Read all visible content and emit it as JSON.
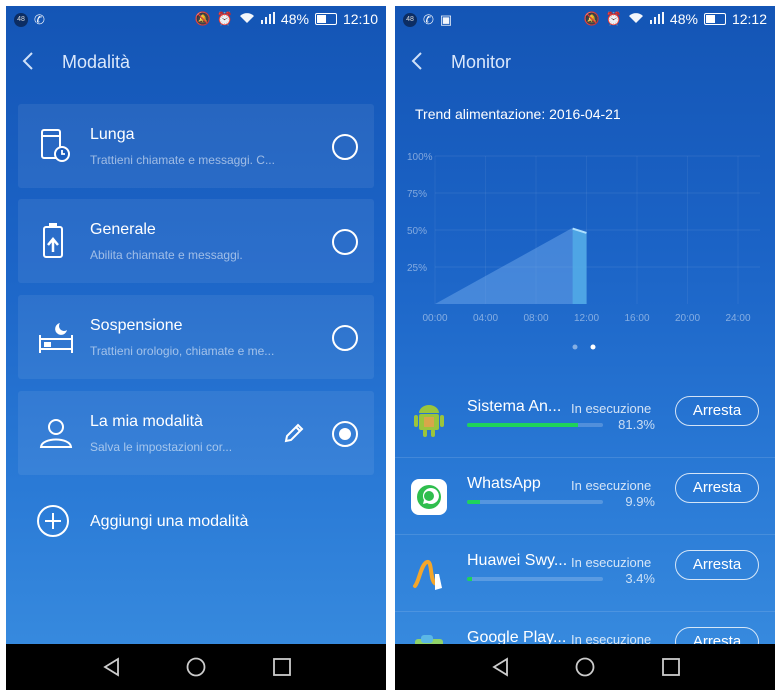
{
  "left": {
    "status": {
      "time": "12:10",
      "battery": "48%",
      "notif_badge": "48"
    },
    "title": "Modalità",
    "modes": [
      {
        "name": "Lunga",
        "desc": "Trattieni chiamate e messaggi. C...",
        "icon": "phone-clock-icon",
        "selected": false
      },
      {
        "name": "Generale",
        "desc": "Abilita chiamate e messaggi.",
        "icon": "battery-up-icon",
        "selected": false
      },
      {
        "name": "Sospensione",
        "desc": "Trattieni orologio, chiamate e me...",
        "icon": "bed-moon-icon",
        "selected": false
      },
      {
        "name": "La mia modalità",
        "desc": "Salva le impostazioni cor...",
        "icon": "user-icon",
        "selected": true
      }
    ],
    "add_label": "Aggiungi una modalità"
  },
  "right": {
    "status": {
      "time": "12:12",
      "battery": "48%",
      "notif_badge": "48"
    },
    "title": "Monitor",
    "chart_title": "Trend alimentazione: 2016-04-21",
    "chart_data": {
      "type": "area",
      "title": "Trend alimentazione: 2016-04-21",
      "x_ticks": [
        "00:00",
        "04:00",
        "08:00",
        "12:00",
        "16:00",
        "20:00",
        "24:00"
      ],
      "y_ticks": [
        "100%",
        "75%",
        "50%",
        "25%"
      ],
      "ylim": [
        0,
        100
      ],
      "x": [
        0,
        10.8,
        10.9,
        12,
        12
      ],
      "y": [
        0,
        51,
        51,
        48,
        0
      ],
      "grid": true
    },
    "stop_label": "Arresta",
    "apps": [
      {
        "name": "Sistema An...",
        "status": "In esecuzione",
        "pct": "81.3%",
        "value": 81.3,
        "icon": "android-icon"
      },
      {
        "name": "WhatsApp",
        "status": "In esecuzione",
        "pct": "9.9%",
        "value": 9.9,
        "icon": "whatsapp-icon"
      },
      {
        "name": "Huawei Swy...",
        "status": "In esecuzione",
        "pct": "3.4%",
        "value": 3.4,
        "icon": "swype-icon"
      },
      {
        "name": "Google Play...",
        "status": "In esecuzione",
        "pct": "",
        "value": 0,
        "icon": "google-play-icon"
      }
    ]
  }
}
